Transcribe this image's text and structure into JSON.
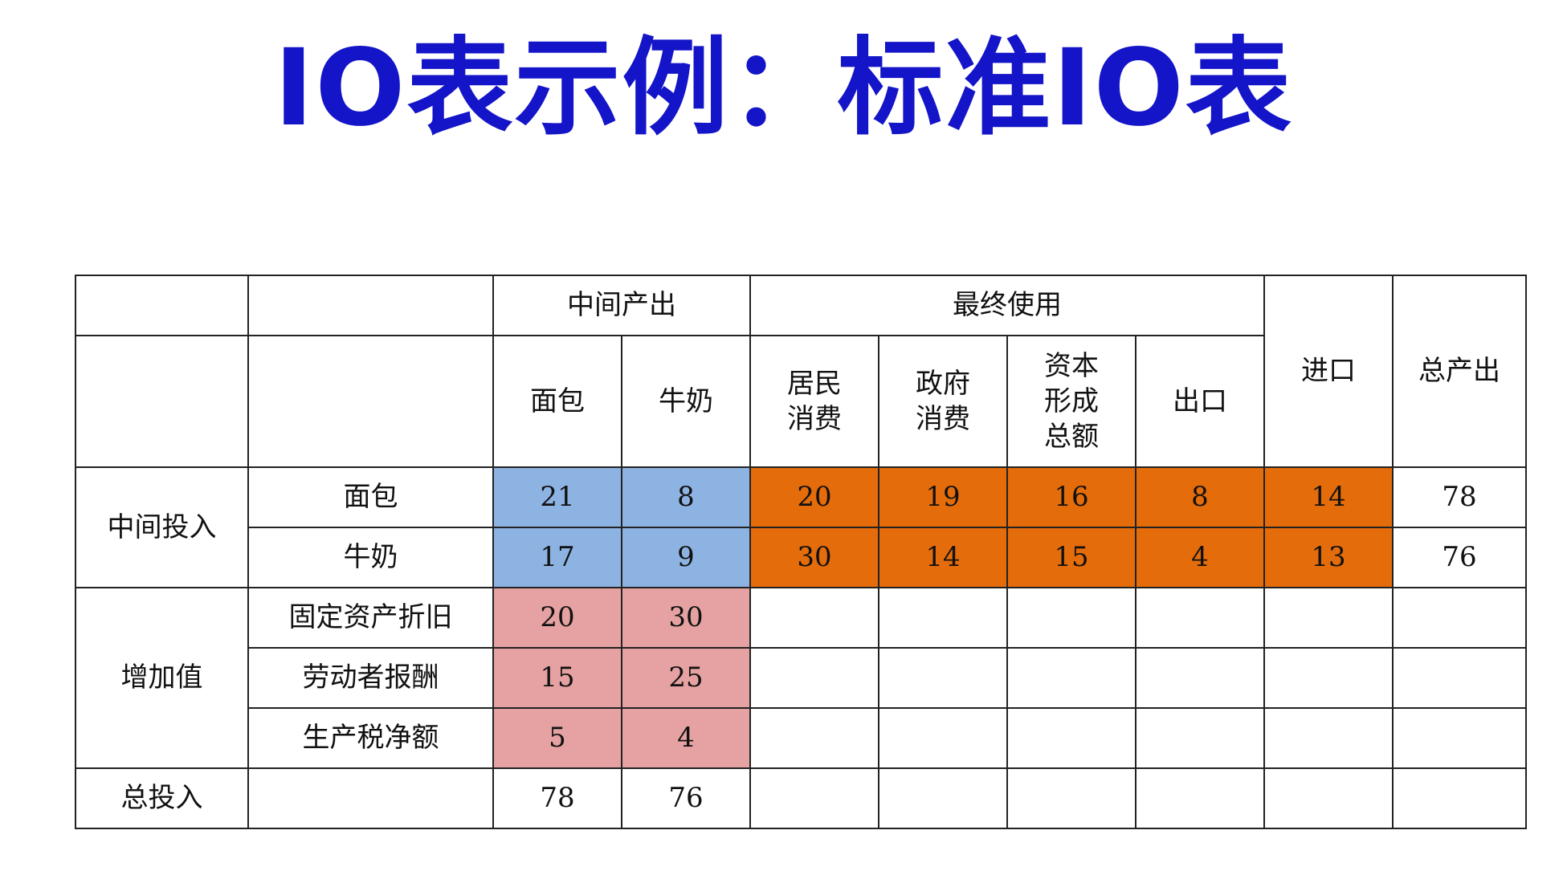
{
  "title": "IO表示例：标准IO表",
  "colors": {
    "title": "#1414c8",
    "intermediate": "#8db3e2",
    "final_use": "#e46c0a",
    "value_added": "#e6a2a2"
  },
  "header": {
    "group_intermediate_output": "中间产出",
    "group_final_use": "最终使用",
    "bread": "面包",
    "milk": "牛奶",
    "household_1": "居民",
    "household_2": "消费",
    "government_1": "政府",
    "government_2": "消费",
    "capital_1": "资本",
    "capital_2": "形成",
    "capital_3": "总额",
    "export": "出口",
    "import": "进口",
    "total_output": "总产出"
  },
  "rows": {
    "intermediate_input": "中间投入",
    "bread": {
      "label": "面包",
      "bread": "21",
      "milk": "8",
      "household": "20",
      "government": "19",
      "capital": "16",
      "export": "8",
      "import": "14",
      "total": "78"
    },
    "milk": {
      "label": "牛奶",
      "bread": "17",
      "milk": "9",
      "household": "30",
      "government": "14",
      "capital": "15",
      "export": "4",
      "import": "13",
      "total": "76"
    },
    "value_added": "增加值",
    "depreciation": {
      "label": "固定资产折旧",
      "bread": "20",
      "milk": "30"
    },
    "compensation": {
      "label": "劳动者报酬",
      "bread": "15",
      "milk": "25"
    },
    "tax": {
      "label": "生产税净额",
      "bread": "5",
      "milk": "4"
    },
    "total_input": {
      "label": "总投入",
      "bread": "78",
      "milk": "76"
    }
  }
}
